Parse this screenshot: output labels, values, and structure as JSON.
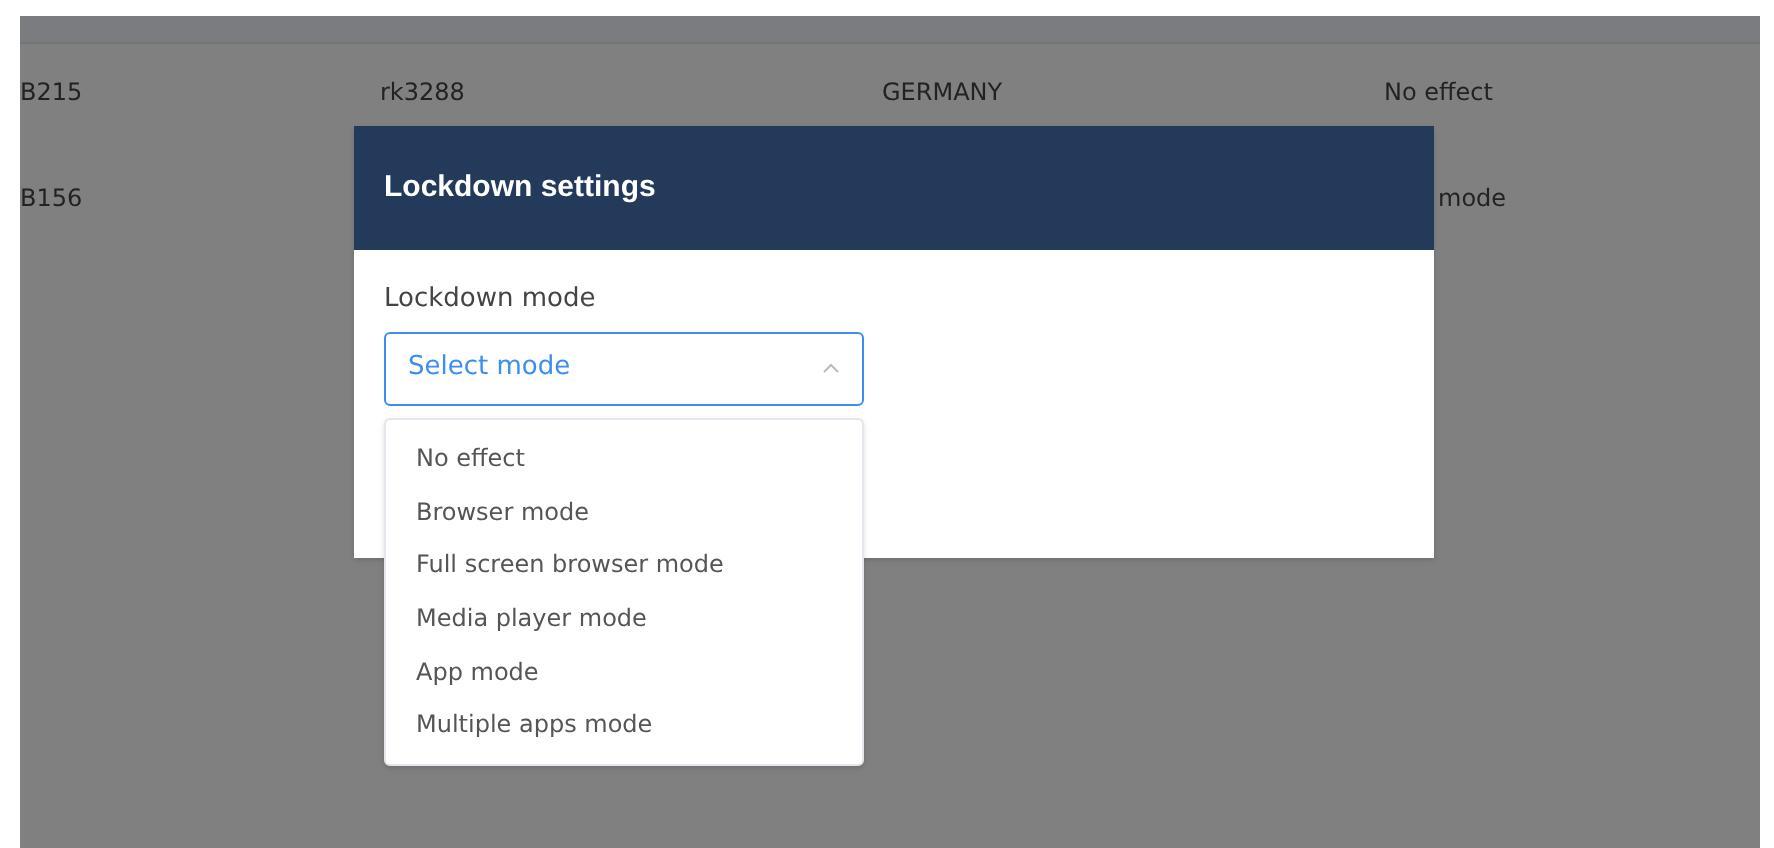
{
  "table": {
    "rows": [
      {
        "cells": [
          "B215",
          "rk3288",
          "GERMANY",
          "No effect"
        ]
      },
      {
        "cells": [
          "B156",
          "",
          "",
          "mode"
        ]
      }
    ]
  },
  "dialog": {
    "title": "Lockdown settings",
    "field_label": "Lockdown mode",
    "select": {
      "placeholder": "Select mode",
      "expanded": true
    },
    "options": [
      {
        "label": "No effect"
      },
      {
        "label": "Browser mode"
      },
      {
        "label": "Full screen browser mode"
      },
      {
        "label": "Media player mode"
      },
      {
        "label": "App mode"
      },
      {
        "label": "Multiple apps mode"
      }
    ]
  }
}
